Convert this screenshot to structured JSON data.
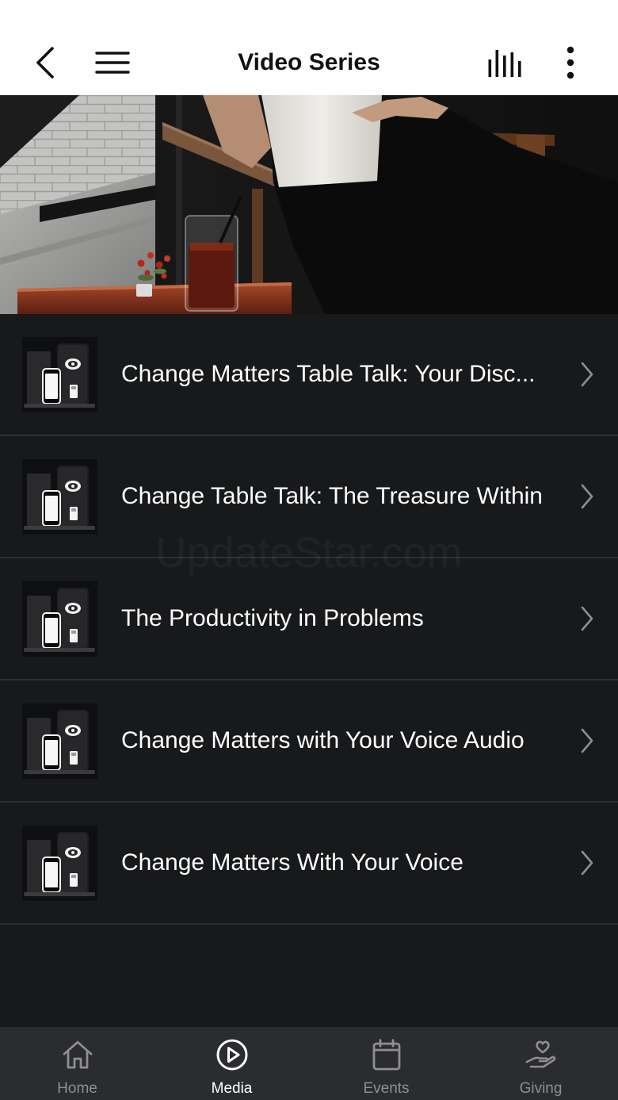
{
  "header": {
    "title": "Video Series",
    "back_icon": "chevron-left-icon",
    "menu_icon": "hamburger-menu-icon",
    "audio_icon": "audio-bars-icon",
    "more_icon": "more-vertical-icon"
  },
  "series": [
    {
      "title": "Change Matters Table Talk: Your Disc...",
      "chevron_icon": "chevron-right-icon"
    },
    {
      "title": "Change Table Talk: The Treasure Within",
      "chevron_icon": "chevron-right-icon"
    },
    {
      "title": "The Productivity in Problems",
      "chevron_icon": "chevron-right-icon"
    },
    {
      "title": "Change Matters with Your Voice Audio",
      "chevron_icon": "chevron-right-icon"
    },
    {
      "title": "Change Matters With Your Voice",
      "chevron_icon": "chevron-right-icon"
    }
  ],
  "watermark": "UpdateStar.com",
  "tabs": [
    {
      "label": "Home",
      "icon": "home-icon",
      "active": false
    },
    {
      "label": "Media",
      "icon": "play-circle-icon",
      "active": true
    },
    {
      "label": "Events",
      "icon": "calendar-icon",
      "active": false
    },
    {
      "label": "Giving",
      "icon": "giving-hand-heart-icon",
      "active": false
    }
  ],
  "colors": {
    "header_bg": "#ffffff",
    "header_text": "#111111",
    "list_bg": "#18191b",
    "divider": "#2e2f32",
    "tab_bar_bg": "#2b2c2f",
    "tab_active": "#ffffff",
    "tab_inactive": "#8e8e93",
    "title_text": "#ffffff",
    "chevron": "#8e8e93"
  }
}
